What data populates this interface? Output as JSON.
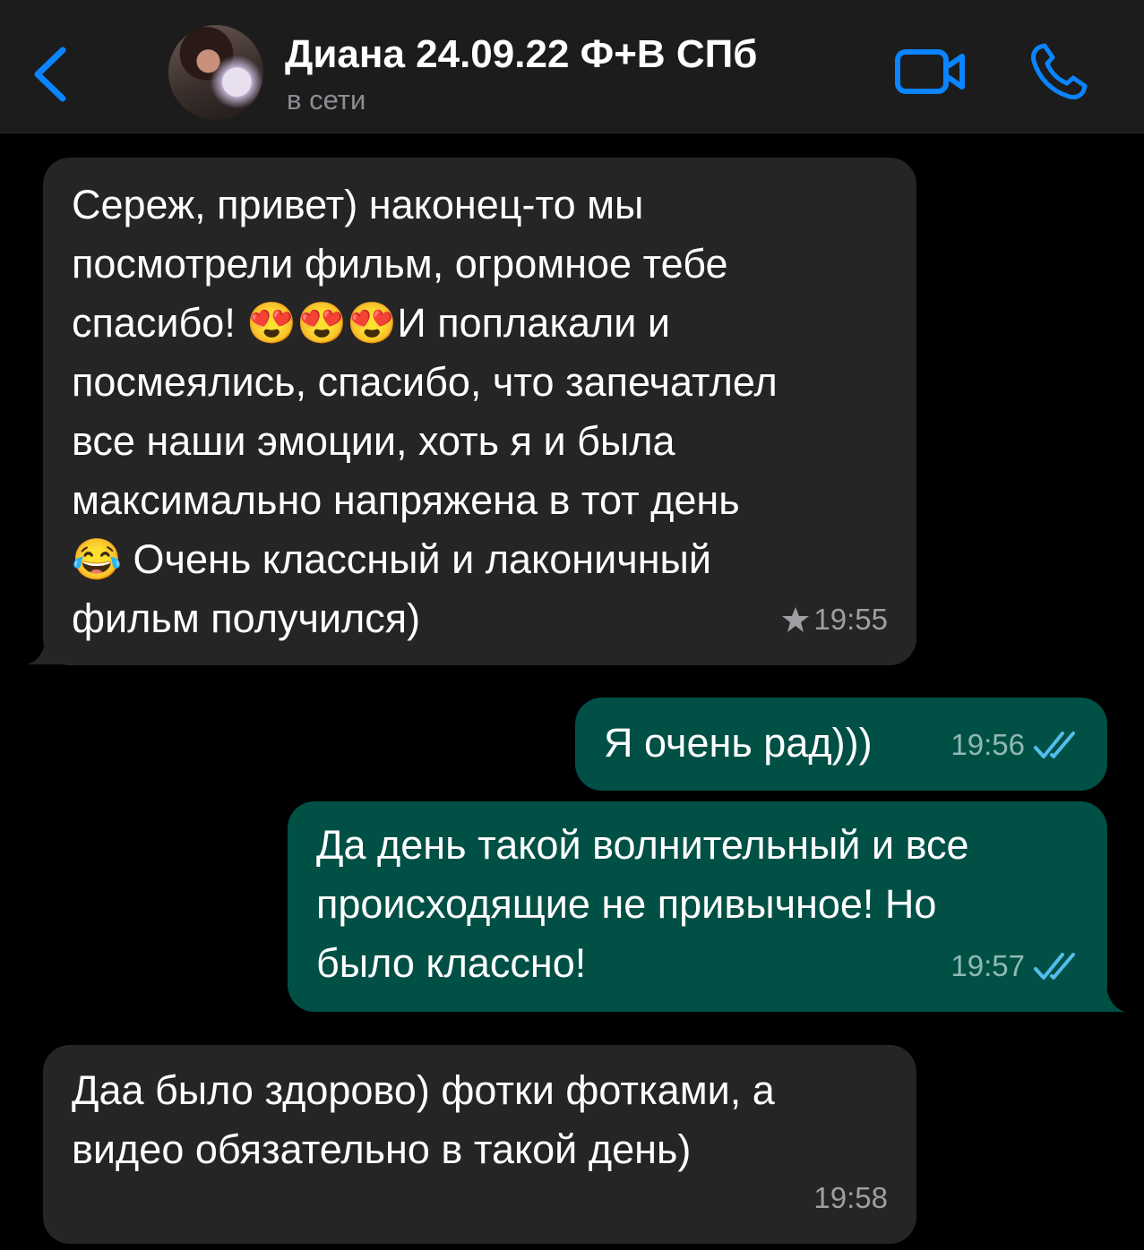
{
  "header": {
    "contact_name": "Диана 24.09.22 Ф+В СПб",
    "status": "в сети"
  },
  "colors": {
    "header_bg": "#1c1c1d",
    "incoming_bubble": "#252526",
    "outgoing_bubble": "#005046",
    "accent_blue": "#0a84ff",
    "read_ticks": "#53bdeb"
  },
  "icons": {
    "back": "chevron-left-icon",
    "video": "video-camera-icon",
    "call": "phone-icon",
    "star": "star-icon",
    "read": "double-check-icon"
  },
  "messages": [
    {
      "direction": "incoming",
      "text": "Сереж, привет) наконец-то мы\nпосмотрели фильм, огромное тебе\nспасибо! 😍😍😍И поплакали и\nпосмеялись, спасибо, что запечатлел\nвсе наши эмоции, хоть я и была\nмаксимально напряжена в тот день\n😂 Очень классный и лаконичный\nфильм получился)",
      "time": "19:55",
      "starred": true
    },
    {
      "direction": "outgoing",
      "text": "Я очень рад)))",
      "time": "19:56",
      "read": true
    },
    {
      "direction": "outgoing",
      "text": "Да день такой волнительный и все\nпроисходящие не привычное! Но\nбыло классно!",
      "time": "19:57",
      "read": true
    },
    {
      "direction": "incoming",
      "text": "Даа было здорово) фотки фотками, а\nвидео обязательно в такой день)",
      "time": "19:58",
      "starred": false
    }
  ]
}
